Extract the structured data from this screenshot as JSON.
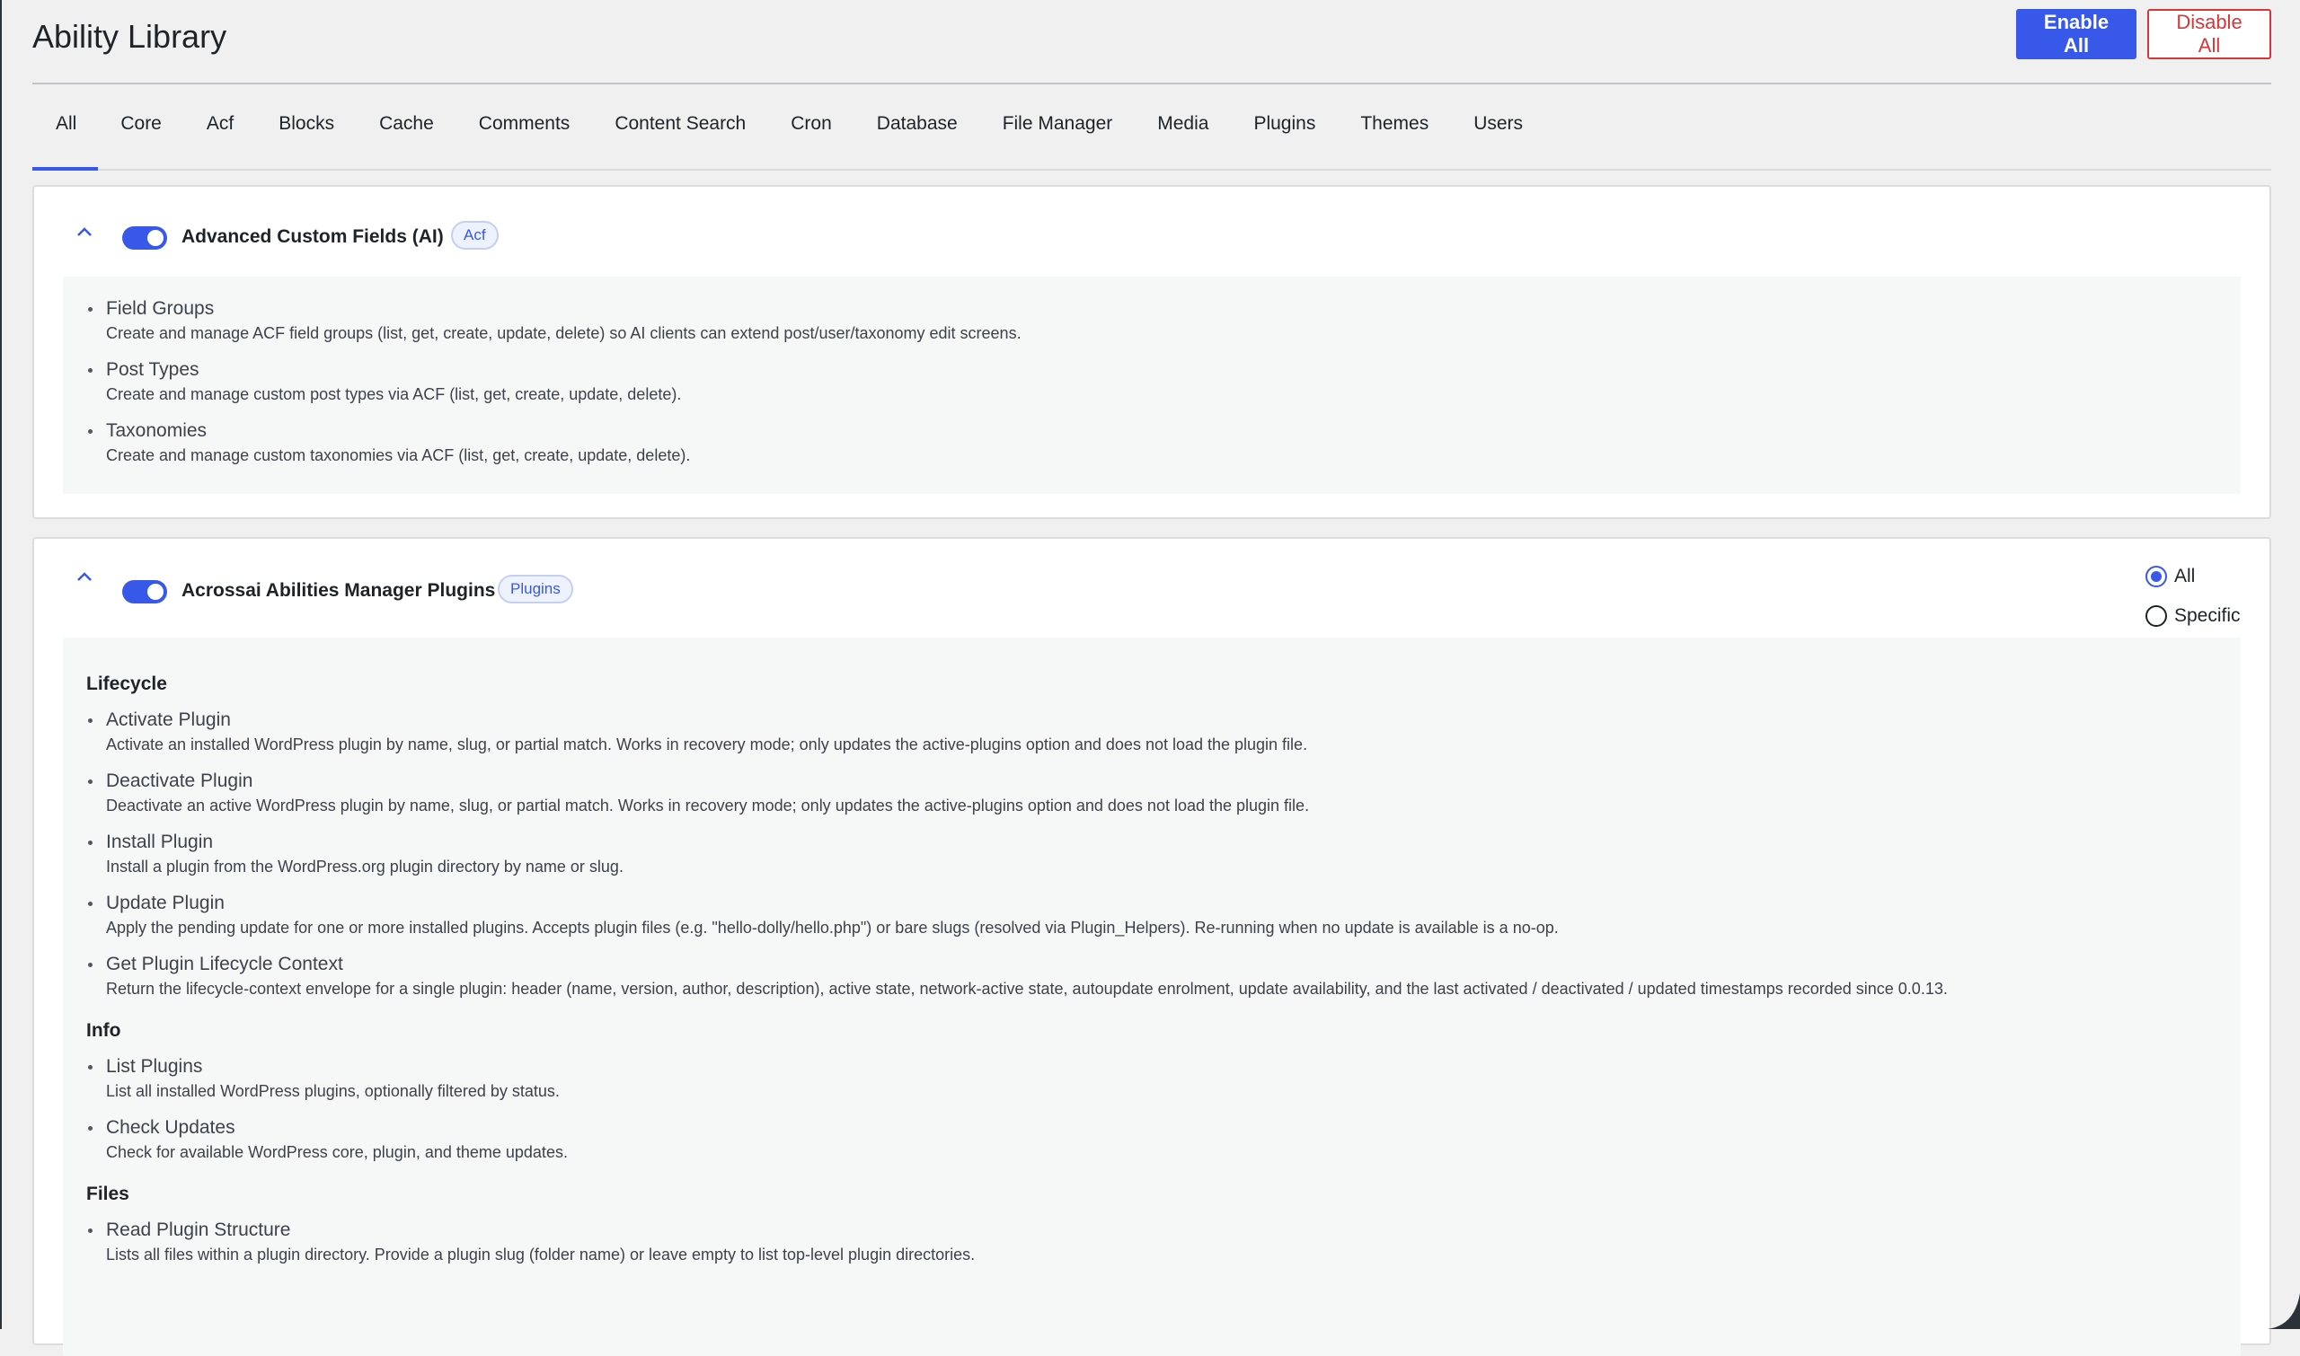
{
  "page": {
    "title": "Ability Library",
    "enable_all": "Enable All",
    "disable_all": "Disable All"
  },
  "tabs": [
    {
      "label": "All",
      "active": true
    },
    {
      "label": "Core"
    },
    {
      "label": "Acf"
    },
    {
      "label": "Blocks"
    },
    {
      "label": "Cache"
    },
    {
      "label": "Comments"
    },
    {
      "label": "Content Search"
    },
    {
      "label": "Cron"
    },
    {
      "label": "Database"
    },
    {
      "label": "File Manager"
    },
    {
      "label": "Media"
    },
    {
      "label": "Plugins"
    },
    {
      "label": "Themes"
    },
    {
      "label": "Users"
    }
  ],
  "panels": [
    {
      "title": "Advanced Custom Fields (AI)",
      "badge": "Acf",
      "enabled": true,
      "items": [
        {
          "title": "Field Groups",
          "desc": "Create and manage ACF field groups (list, get, create, update, delete) so AI clients can extend post/user/taxonomy edit screens."
        },
        {
          "title": "Post Types",
          "desc": "Create and manage custom post types via ACF (list, get, create, update, delete)."
        },
        {
          "title": "Taxonomies",
          "desc": "Create and manage custom taxonomies via ACF (list, get, create, update, delete)."
        }
      ]
    },
    {
      "title": "Acrossai Abilities Manager Plugins",
      "badge": "Plugins",
      "enabled": true,
      "scope": {
        "options": [
          "All",
          "Specific"
        ],
        "selected": "All"
      },
      "groups": [
        {
          "title": "Lifecycle",
          "items": [
            {
              "title": "Activate Plugin",
              "desc": "Activate an installed WordPress plugin by name, slug, or partial match. Works in recovery mode; only updates the active-plugins option and does not load the plugin file."
            },
            {
              "title": "Deactivate Plugin",
              "desc": "Deactivate an active WordPress plugin by name, slug, or partial match. Works in recovery mode; only updates the active-plugins option and does not load the plugin file."
            },
            {
              "title": "Install Plugin",
              "desc": "Install a plugin from the WordPress.org plugin directory by name or slug."
            },
            {
              "title": "Update Plugin",
              "desc": "Apply the pending update for one or more installed plugins. Accepts plugin files (e.g. \"hello-dolly/hello.php\") or bare slugs (resolved via Plugin_Helpers). Re-running when no update is available is a no-op."
            },
            {
              "title": "Get Plugin Lifecycle Context",
              "desc": "Return the lifecycle-context envelope for a single plugin: header (name, version, author, description), active state, network-active state, autoupdate enrolment, update availability, and the last activated / deactivated / updated timestamps recorded since 0.0.13."
            }
          ]
        },
        {
          "title": "Info",
          "items": [
            {
              "title": "List Plugins",
              "desc": "List all installed WordPress plugins, optionally filtered by status."
            },
            {
              "title": "Check Updates",
              "desc": "Check for available WordPress core, plugin, and theme updates."
            }
          ]
        },
        {
          "title": "Files",
          "items": [
            {
              "title": "Read Plugin Structure",
              "desc": "Lists all files within a plugin directory. Provide a plugin slug (folder name) or leave empty to list top-level plugin directories."
            }
          ]
        }
      ]
    }
  ],
  "colors": {
    "accent": "#3858e9",
    "danger": "#d63638",
    "background": "#f0f0f1"
  }
}
